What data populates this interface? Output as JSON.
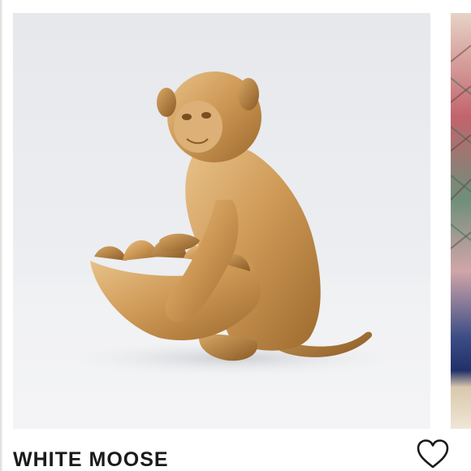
{
  "listing": {
    "brand": "WHITE MOOSE",
    "like_icon": "heart-outline-icon"
  },
  "colors": {
    "brand_text": "#1a1a1a",
    "backdrop": "#eceef1",
    "statue_gold": "#cf9a57"
  },
  "carousel": {
    "images": [
      {
        "subject": "gold-monkey-statue-with-leaf-bowl",
        "visible": "full"
      },
      {
        "subject": "colorful-painting-on-blue-sofa",
        "visible": "partial"
      }
    ]
  }
}
